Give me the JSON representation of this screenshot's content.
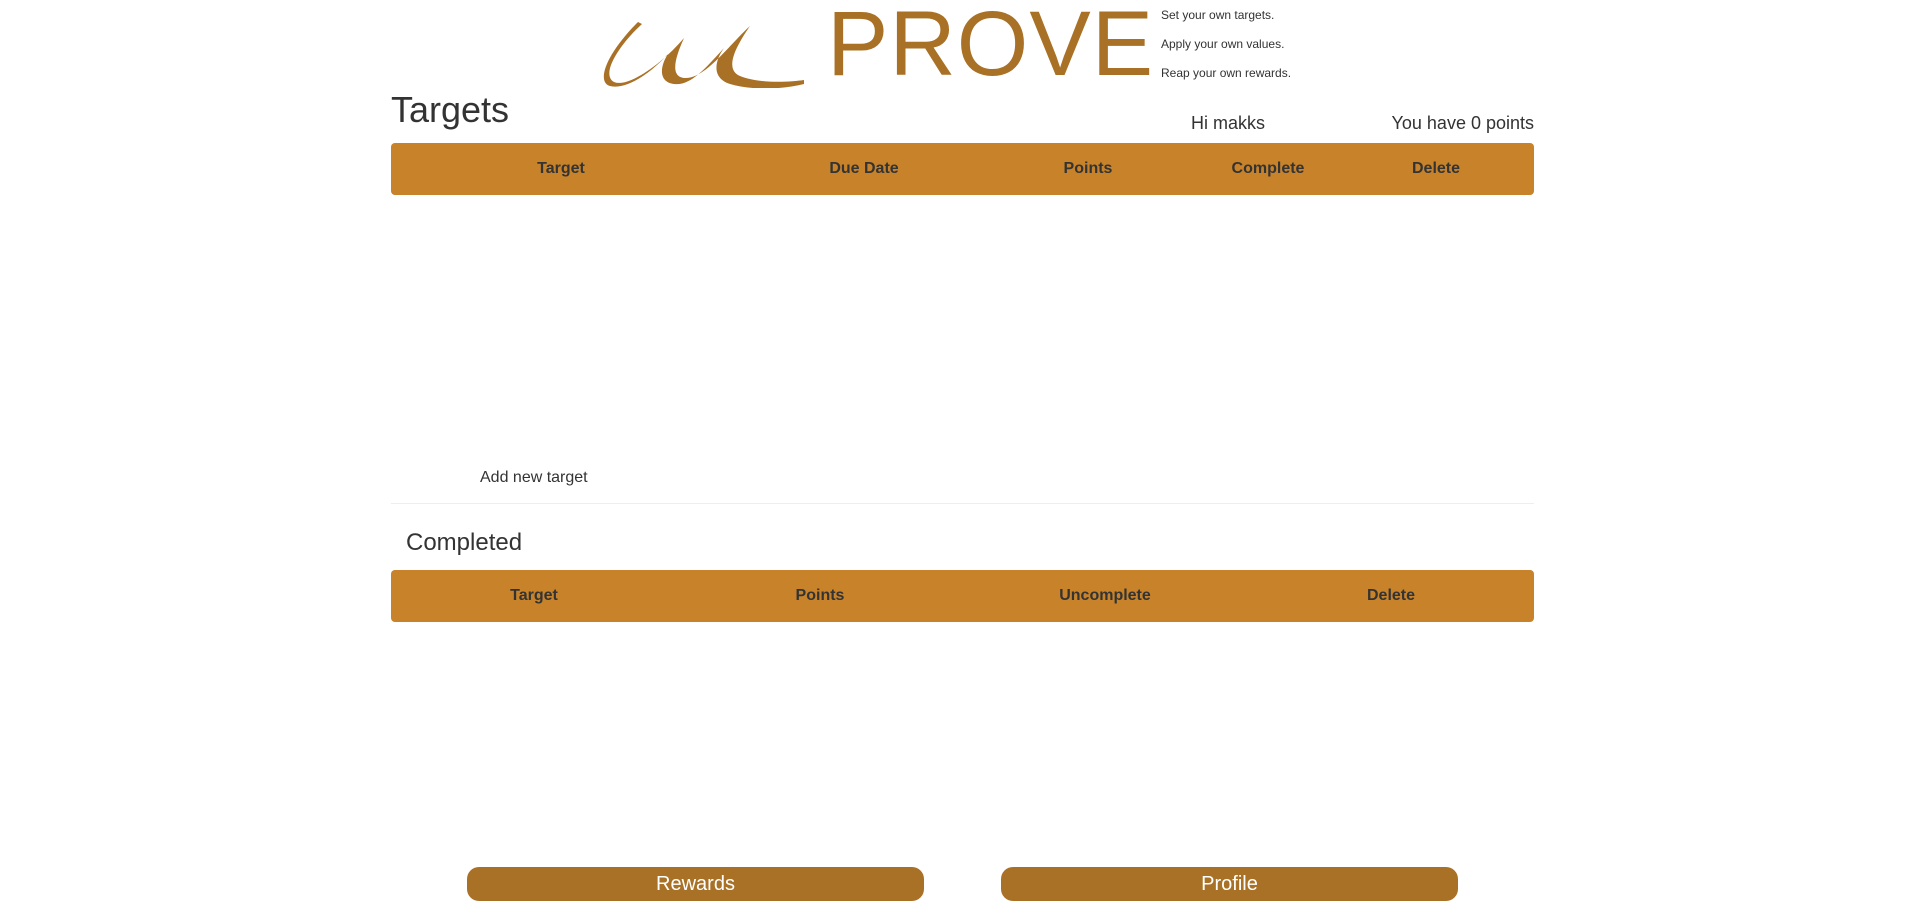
{
  "brand": {
    "logo_mark": "cursive-u-logo",
    "name": "PROVE",
    "color": "#a97126",
    "taglines": [
      "Set your own targets.",
      "Apply your own values.",
      "Reap your own rewards."
    ]
  },
  "user": {
    "greeting": "Hi makks",
    "points_text": "You have 0 points"
  },
  "targets": {
    "title": "Targets",
    "header_color": "#c8832a",
    "columns": [
      "Target",
      "Due Date",
      "Points",
      "Complete",
      "Delete"
    ],
    "rows": [],
    "add_label": "Add new target"
  },
  "completed": {
    "title": "Completed",
    "columns": [
      "Target",
      "Points",
      "Uncomplete",
      "Delete"
    ],
    "rows": []
  },
  "nav": {
    "rewards_label": "Rewards",
    "profile_label": "Profile"
  }
}
